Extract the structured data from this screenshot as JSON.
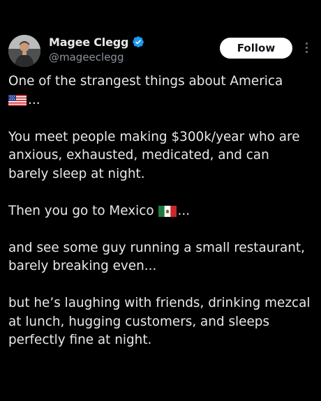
{
  "author": {
    "display_name": "Magee Clegg",
    "handle": "@mageeclegg",
    "verified": true,
    "verified_color": "#1d9bf0"
  },
  "actions": {
    "follow_label": "Follow",
    "more_icon": "more-vertical-icon"
  },
  "post": {
    "para1": {
      "text": "One of the strangest things about America",
      "flag": "us-flag-icon",
      "suffix": "..."
    },
    "para2": "You meet people making $300k/year who are anxious, exhausted, medicated, and can barely sleep at night.",
    "para3": {
      "text": "Then you go to Mexico",
      "flag": "mexico-flag-icon",
      "suffix": "..."
    },
    "para4": "and see some guy running a small restaurant, barely breaking even...",
    "para5": "but he’s laughing with friends, drinking mezcal at lunch, hugging customers, and sleeps perfectly fine at night."
  },
  "colors": {
    "background": "#000000",
    "text": "#e7e9ea",
    "secondary_text": "#8b949c",
    "button_bg": "#ffffff",
    "button_text": "#0f1419"
  }
}
